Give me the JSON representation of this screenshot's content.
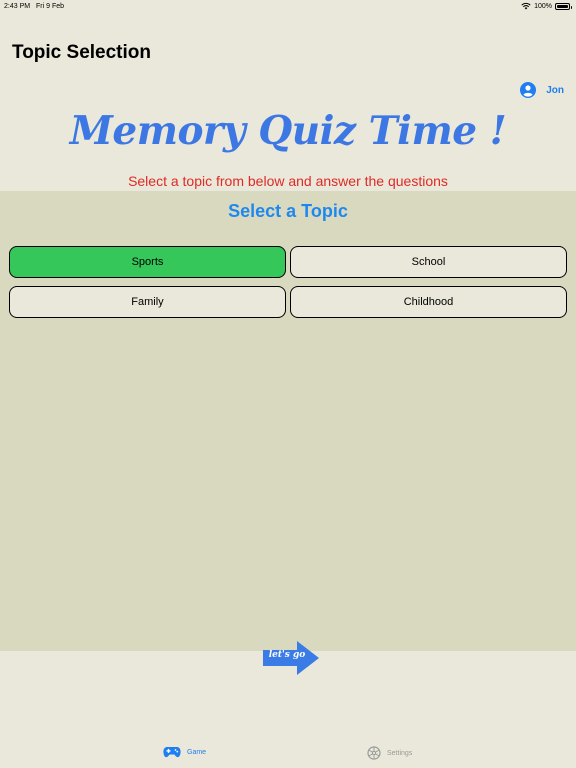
{
  "status_bar": {
    "time": "2:43 PM",
    "date": "Fri 9 Feb",
    "battery": "100%"
  },
  "nav": {
    "title": "Topic Selection",
    "user_name": "Jon",
    "user_icon": "person-circle-icon"
  },
  "header": {
    "app_title": "Memory Quiz Time !",
    "subtitle": "Select a topic from below and answer the questions"
  },
  "topic_panel": {
    "title": "Select a Topic",
    "topics": [
      {
        "label": "Sports",
        "selected": true
      },
      {
        "label": "School",
        "selected": false
      },
      {
        "label": "Family",
        "selected": false
      },
      {
        "label": "Childhood",
        "selected": false
      }
    ]
  },
  "go_button": {
    "label": "let's go",
    "icon": "arrow-right-icon"
  },
  "tab_bar": {
    "tabs": [
      {
        "label": "Game",
        "icon": "gamecontroller-icon",
        "active": true
      },
      {
        "label": "Settings",
        "icon": "gear-icon",
        "active": false
      }
    ]
  },
  "colors": {
    "background": "#e9e8da",
    "panel": "#d9d9bf",
    "accent_blue": "#1f7ef0",
    "title_blue": "#3c77e4",
    "subtitle_red": "#e02a26",
    "selected_green": "#35c759"
  }
}
